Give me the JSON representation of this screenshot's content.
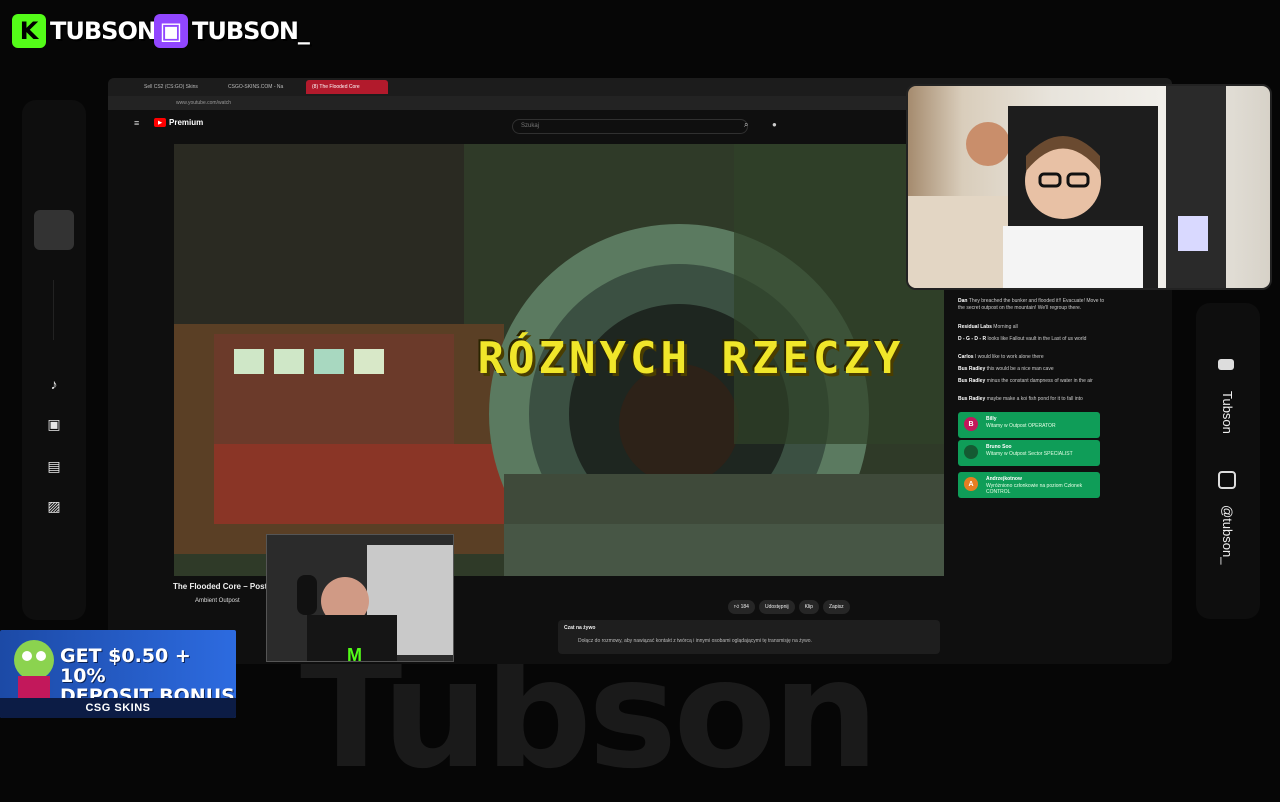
{
  "brand": {
    "kick_name": "TUBSON",
    "twitch_name": "TUBSON_",
    "watermark": "Tubson"
  },
  "browser": {
    "tabs": [
      "Sell CS2 (CS:GO) Skins",
      "CSGO-SKINS.COM - Na",
      "(8) The Flooded Core"
    ],
    "url": "www.youtube.com/watch"
  },
  "youtube": {
    "logo_text": "Premium",
    "search_placeholder": "Szukaj",
    "video_caption": "RÓZNYCH RZECZY",
    "video_title": "The Flooded Core – Post",
    "channel": "Ambient Outpost",
    "likes": "184",
    "share": "Udostępnij",
    "clip": "Klip",
    "save": "Zapisz",
    "chat_title": "Czat na żywo",
    "chat_prompt": "Dołącz do rozmowy, aby nawiązać kontakt z twórcą i innymi osobami oglądającymi tę transmisję na żywo."
  },
  "live_chat": {
    "messages": [
      {
        "user": "Dan",
        "text": "They breached the bunker and flooded it!! Evacuate! Move to the secret outpost on the mountain! We'll regroup there."
      },
      {
        "user": "Residual Labs",
        "text": "Morning all"
      },
      {
        "user": "D - G - D - R",
        "text": "looks like Fallout vault in the Last of us world"
      },
      {
        "user": "Carlos",
        "text": "I would like to work alone there"
      },
      {
        "user": "Bus Radley",
        "text": "this would be a nice man cave"
      },
      {
        "user": "Bus Radley",
        "text": "minus the constant dampness of water in the air"
      },
      {
        "user": "Bus Radley",
        "text": "maybe make a koi fish pond for it to fall into"
      }
    ],
    "gifts": [
      {
        "initial": "B",
        "user": "Billy",
        "text": "Witamy w Outpost OPERATOR"
      },
      {
        "initial": "",
        "user": "Bruno Soo",
        "text": "Witamy w Outpost Sector SPECIALIST"
      },
      {
        "initial": "A",
        "user": "Andrzejkotnow",
        "text": "Wyróżniono członkowie na poziom Członek CONTROL"
      }
    ]
  },
  "socials": {
    "youtube_handle": "Tubson",
    "instagram_handle": "@tubson_"
  },
  "ad": {
    "headline_line1": "GET $0.50 + 10%",
    "headline_line2": "DEPOSIT BONUS",
    "brand": "CSG SKINS"
  },
  "colors": {
    "kick_green": "#53fc18",
    "twitch_purple": "#9146ff",
    "youtube_red": "#ff0000",
    "caption_yellow": "#f0e62a",
    "gift_green": "#0f9d58"
  }
}
